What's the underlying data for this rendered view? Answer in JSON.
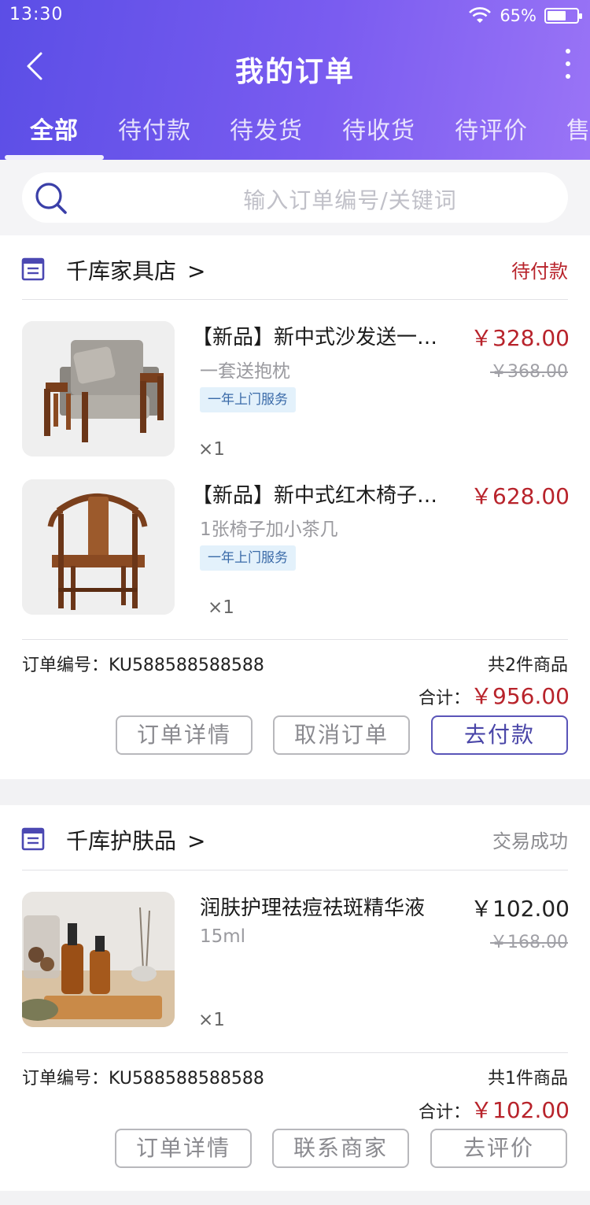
{
  "status_bar": {
    "time": "13:30",
    "battery": "65%",
    "battery_level": 0.65
  },
  "header": {
    "title": "我的订单"
  },
  "tabs": [
    "全部",
    "待付款",
    "待发货",
    "待收货",
    "待评价",
    "售"
  ],
  "search": {
    "placeholder": "输入订单编号/关键词"
  },
  "colors": {
    "accent": "#5b4ee6",
    "price_red": "#b8232b",
    "pending_red": "#b8232b",
    "success_gray": "#8c8c90"
  },
  "orders": [
    {
      "shop": "千库家具店",
      "arrow": ">",
      "status": "待付款",
      "items": [
        {
          "name": "【新品】新中式沙发送一套送抱枕",
          "spec": "一套送抱枕",
          "service": "一年上门服务",
          "qty": "×1",
          "price": "￥328.00",
          "original": "￥368.00"
        },
        {
          "name": "【新品】新中式红木椅子加小茶几",
          "spec": "1张椅子加小茶几",
          "service": "一年上门服务",
          "qty": "×1",
          "price": "￥628.00"
        }
      ],
      "order_no": "订单编号：KU588588588588",
      "count": "共2件商品",
      "total_label": "合计：",
      "total": "￥956.00",
      "buttons": [
        "订单详情",
        "取消订单",
        "去付款"
      ]
    },
    {
      "shop": "千库护肤品",
      "arrow": ">",
      "status": "交易成功",
      "items": [
        {
          "name": "润肤护理祛痘祛斑精华液",
          "spec": "15ml",
          "qty": "×1",
          "price": "￥102.00",
          "original": "￥168.00"
        }
      ],
      "order_no": "订单编号：KU588588588588",
      "count": "共1件商品",
      "total_label": "合计：",
      "total": "￥102.00",
      "buttons": [
        "订单详情",
        "联系商家",
        "去评价"
      ]
    }
  ]
}
